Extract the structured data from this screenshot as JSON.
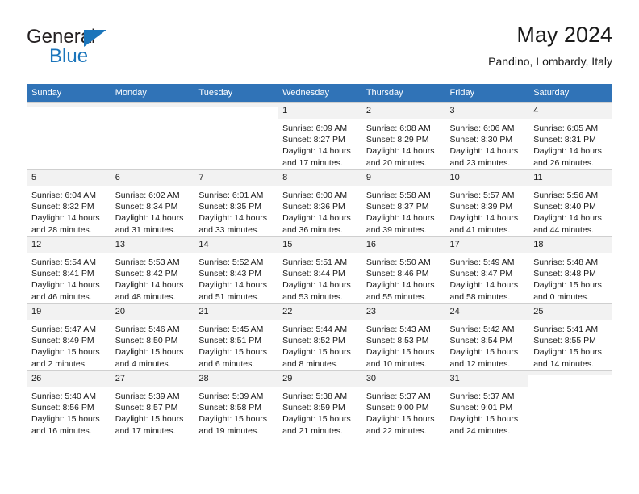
{
  "brand": {
    "name_top": "General",
    "name_bottom": "Blue",
    "accent_color": "#1b75bb",
    "triangle_icon": "triangle-icon"
  },
  "header": {
    "title": "May 2024",
    "subtitle": "Pandino, Lombardy, Italy"
  },
  "theme": {
    "header_bg": "#3073b7",
    "daynum_bg": "#f2f2f2",
    "grid_line": "#cfcfcf"
  },
  "weekdays": [
    "Sunday",
    "Monday",
    "Tuesday",
    "Wednesday",
    "Thursday",
    "Friday",
    "Saturday"
  ],
  "labels": {
    "sunrise_prefix": "Sunrise:",
    "sunset_prefix": "Sunset:",
    "daylight_prefix": "Daylight:"
  },
  "weeks": [
    [
      {
        "day": "",
        "empty": true
      },
      {
        "day": "",
        "empty": true
      },
      {
        "day": "",
        "empty": true
      },
      {
        "day": "1",
        "sunrise": "Sunrise: 6:09 AM",
        "sunset": "Sunset: 8:27 PM",
        "daylight1": "Daylight: 14 hours",
        "daylight2": "and 17 minutes."
      },
      {
        "day": "2",
        "sunrise": "Sunrise: 6:08 AM",
        "sunset": "Sunset: 8:29 PM",
        "daylight1": "Daylight: 14 hours",
        "daylight2": "and 20 minutes."
      },
      {
        "day": "3",
        "sunrise": "Sunrise: 6:06 AM",
        "sunset": "Sunset: 8:30 PM",
        "daylight1": "Daylight: 14 hours",
        "daylight2": "and 23 minutes."
      },
      {
        "day": "4",
        "sunrise": "Sunrise: 6:05 AM",
        "sunset": "Sunset: 8:31 PM",
        "daylight1": "Daylight: 14 hours",
        "daylight2": "and 26 minutes."
      }
    ],
    [
      {
        "day": "5",
        "sunrise": "Sunrise: 6:04 AM",
        "sunset": "Sunset: 8:32 PM",
        "daylight1": "Daylight: 14 hours",
        "daylight2": "and 28 minutes."
      },
      {
        "day": "6",
        "sunrise": "Sunrise: 6:02 AM",
        "sunset": "Sunset: 8:34 PM",
        "daylight1": "Daylight: 14 hours",
        "daylight2": "and 31 minutes."
      },
      {
        "day": "7",
        "sunrise": "Sunrise: 6:01 AM",
        "sunset": "Sunset: 8:35 PM",
        "daylight1": "Daylight: 14 hours",
        "daylight2": "and 33 minutes."
      },
      {
        "day": "8",
        "sunrise": "Sunrise: 6:00 AM",
        "sunset": "Sunset: 8:36 PM",
        "daylight1": "Daylight: 14 hours",
        "daylight2": "and 36 minutes."
      },
      {
        "day": "9",
        "sunrise": "Sunrise: 5:58 AM",
        "sunset": "Sunset: 8:37 PM",
        "daylight1": "Daylight: 14 hours",
        "daylight2": "and 39 minutes."
      },
      {
        "day": "10",
        "sunrise": "Sunrise: 5:57 AM",
        "sunset": "Sunset: 8:39 PM",
        "daylight1": "Daylight: 14 hours",
        "daylight2": "and 41 minutes."
      },
      {
        "day": "11",
        "sunrise": "Sunrise: 5:56 AM",
        "sunset": "Sunset: 8:40 PM",
        "daylight1": "Daylight: 14 hours",
        "daylight2": "and 44 minutes."
      }
    ],
    [
      {
        "day": "12",
        "sunrise": "Sunrise: 5:54 AM",
        "sunset": "Sunset: 8:41 PM",
        "daylight1": "Daylight: 14 hours",
        "daylight2": "and 46 minutes."
      },
      {
        "day": "13",
        "sunrise": "Sunrise: 5:53 AM",
        "sunset": "Sunset: 8:42 PM",
        "daylight1": "Daylight: 14 hours",
        "daylight2": "and 48 minutes."
      },
      {
        "day": "14",
        "sunrise": "Sunrise: 5:52 AM",
        "sunset": "Sunset: 8:43 PM",
        "daylight1": "Daylight: 14 hours",
        "daylight2": "and 51 minutes."
      },
      {
        "day": "15",
        "sunrise": "Sunrise: 5:51 AM",
        "sunset": "Sunset: 8:44 PM",
        "daylight1": "Daylight: 14 hours",
        "daylight2": "and 53 minutes."
      },
      {
        "day": "16",
        "sunrise": "Sunrise: 5:50 AM",
        "sunset": "Sunset: 8:46 PM",
        "daylight1": "Daylight: 14 hours",
        "daylight2": "and 55 minutes."
      },
      {
        "day": "17",
        "sunrise": "Sunrise: 5:49 AM",
        "sunset": "Sunset: 8:47 PM",
        "daylight1": "Daylight: 14 hours",
        "daylight2": "and 58 minutes."
      },
      {
        "day": "18",
        "sunrise": "Sunrise: 5:48 AM",
        "sunset": "Sunset: 8:48 PM",
        "daylight1": "Daylight: 15 hours",
        "daylight2": "and 0 minutes."
      }
    ],
    [
      {
        "day": "19",
        "sunrise": "Sunrise: 5:47 AM",
        "sunset": "Sunset: 8:49 PM",
        "daylight1": "Daylight: 15 hours",
        "daylight2": "and 2 minutes."
      },
      {
        "day": "20",
        "sunrise": "Sunrise: 5:46 AM",
        "sunset": "Sunset: 8:50 PM",
        "daylight1": "Daylight: 15 hours",
        "daylight2": "and 4 minutes."
      },
      {
        "day": "21",
        "sunrise": "Sunrise: 5:45 AM",
        "sunset": "Sunset: 8:51 PM",
        "daylight1": "Daylight: 15 hours",
        "daylight2": "and 6 minutes."
      },
      {
        "day": "22",
        "sunrise": "Sunrise: 5:44 AM",
        "sunset": "Sunset: 8:52 PM",
        "daylight1": "Daylight: 15 hours",
        "daylight2": "and 8 minutes."
      },
      {
        "day": "23",
        "sunrise": "Sunrise: 5:43 AM",
        "sunset": "Sunset: 8:53 PM",
        "daylight1": "Daylight: 15 hours",
        "daylight2": "and 10 minutes."
      },
      {
        "day": "24",
        "sunrise": "Sunrise: 5:42 AM",
        "sunset": "Sunset: 8:54 PM",
        "daylight1": "Daylight: 15 hours",
        "daylight2": "and 12 minutes."
      },
      {
        "day": "25",
        "sunrise": "Sunrise: 5:41 AM",
        "sunset": "Sunset: 8:55 PM",
        "daylight1": "Daylight: 15 hours",
        "daylight2": "and 14 minutes."
      }
    ],
    [
      {
        "day": "26",
        "sunrise": "Sunrise: 5:40 AM",
        "sunset": "Sunset: 8:56 PM",
        "daylight1": "Daylight: 15 hours",
        "daylight2": "and 16 minutes."
      },
      {
        "day": "27",
        "sunrise": "Sunrise: 5:39 AM",
        "sunset": "Sunset: 8:57 PM",
        "daylight1": "Daylight: 15 hours",
        "daylight2": "and 17 minutes."
      },
      {
        "day": "28",
        "sunrise": "Sunrise: 5:39 AM",
        "sunset": "Sunset: 8:58 PM",
        "daylight1": "Daylight: 15 hours",
        "daylight2": "and 19 minutes."
      },
      {
        "day": "29",
        "sunrise": "Sunrise: 5:38 AM",
        "sunset": "Sunset: 8:59 PM",
        "daylight1": "Daylight: 15 hours",
        "daylight2": "and 21 minutes."
      },
      {
        "day": "30",
        "sunrise": "Sunrise: 5:37 AM",
        "sunset": "Sunset: 9:00 PM",
        "daylight1": "Daylight: 15 hours",
        "daylight2": "and 22 minutes."
      },
      {
        "day": "31",
        "sunrise": "Sunrise: 5:37 AM",
        "sunset": "Sunset: 9:01 PM",
        "daylight1": "Daylight: 15 hours",
        "daylight2": "and 24 minutes."
      },
      {
        "day": "",
        "empty": true
      }
    ]
  ]
}
